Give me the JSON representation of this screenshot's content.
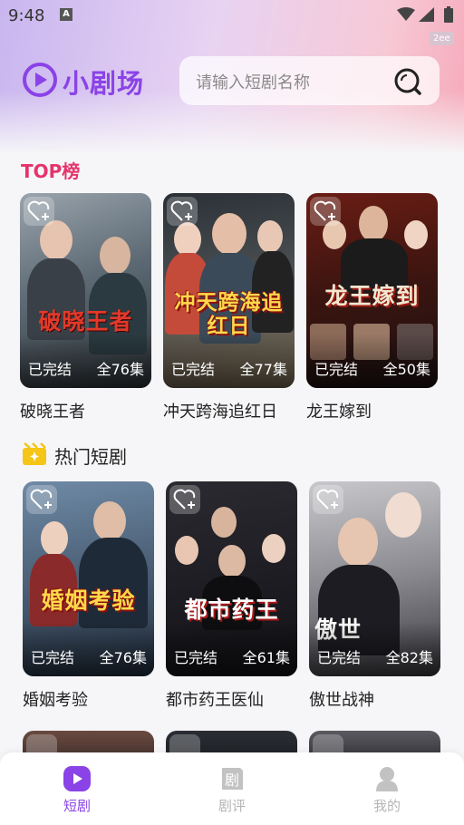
{
  "status_bar": {
    "time": "9:48",
    "badge": "2ee"
  },
  "app": {
    "name": "小剧场"
  },
  "search": {
    "placeholder": "请输入短剧名称"
  },
  "sections": {
    "top": {
      "title": "TOP榜"
    },
    "hot": {
      "title": "热门短剧"
    }
  },
  "top_list": [
    {
      "title": "破晓王者",
      "poster_text": "破晓王者",
      "status": "已完结",
      "episodes": "全76集"
    },
    {
      "title": "冲天跨海追红日",
      "poster_text": "冲天跨海追红日",
      "status": "已完结",
      "episodes": "全77集"
    },
    {
      "title": "龙王嫁到",
      "poster_text": "龙王嫁到",
      "status": "已完结",
      "episodes": "全50集"
    }
  ],
  "hot_list": [
    {
      "title": "婚姻考验",
      "poster_text": "婚姻考验",
      "status": "已完结",
      "episodes": "全76集"
    },
    {
      "title": "都市药王医仙",
      "poster_text": "都市药王",
      "status": "已完结",
      "episodes": "全61集"
    },
    {
      "title": "傲世战神",
      "poster_text": "傲世",
      "status": "已完结",
      "episodes": "全82集"
    }
  ],
  "tabbar": [
    {
      "label": "短剧",
      "icon": "play-icon",
      "active": true
    },
    {
      "label": "剧评",
      "icon": "review-icon",
      "active": false
    },
    {
      "label": "我的",
      "icon": "user-icon",
      "active": false
    }
  ],
  "colors": {
    "accent": "#8a43e6",
    "top_title": "#e5346d",
    "inactive_tab": "#b5b5b5"
  }
}
